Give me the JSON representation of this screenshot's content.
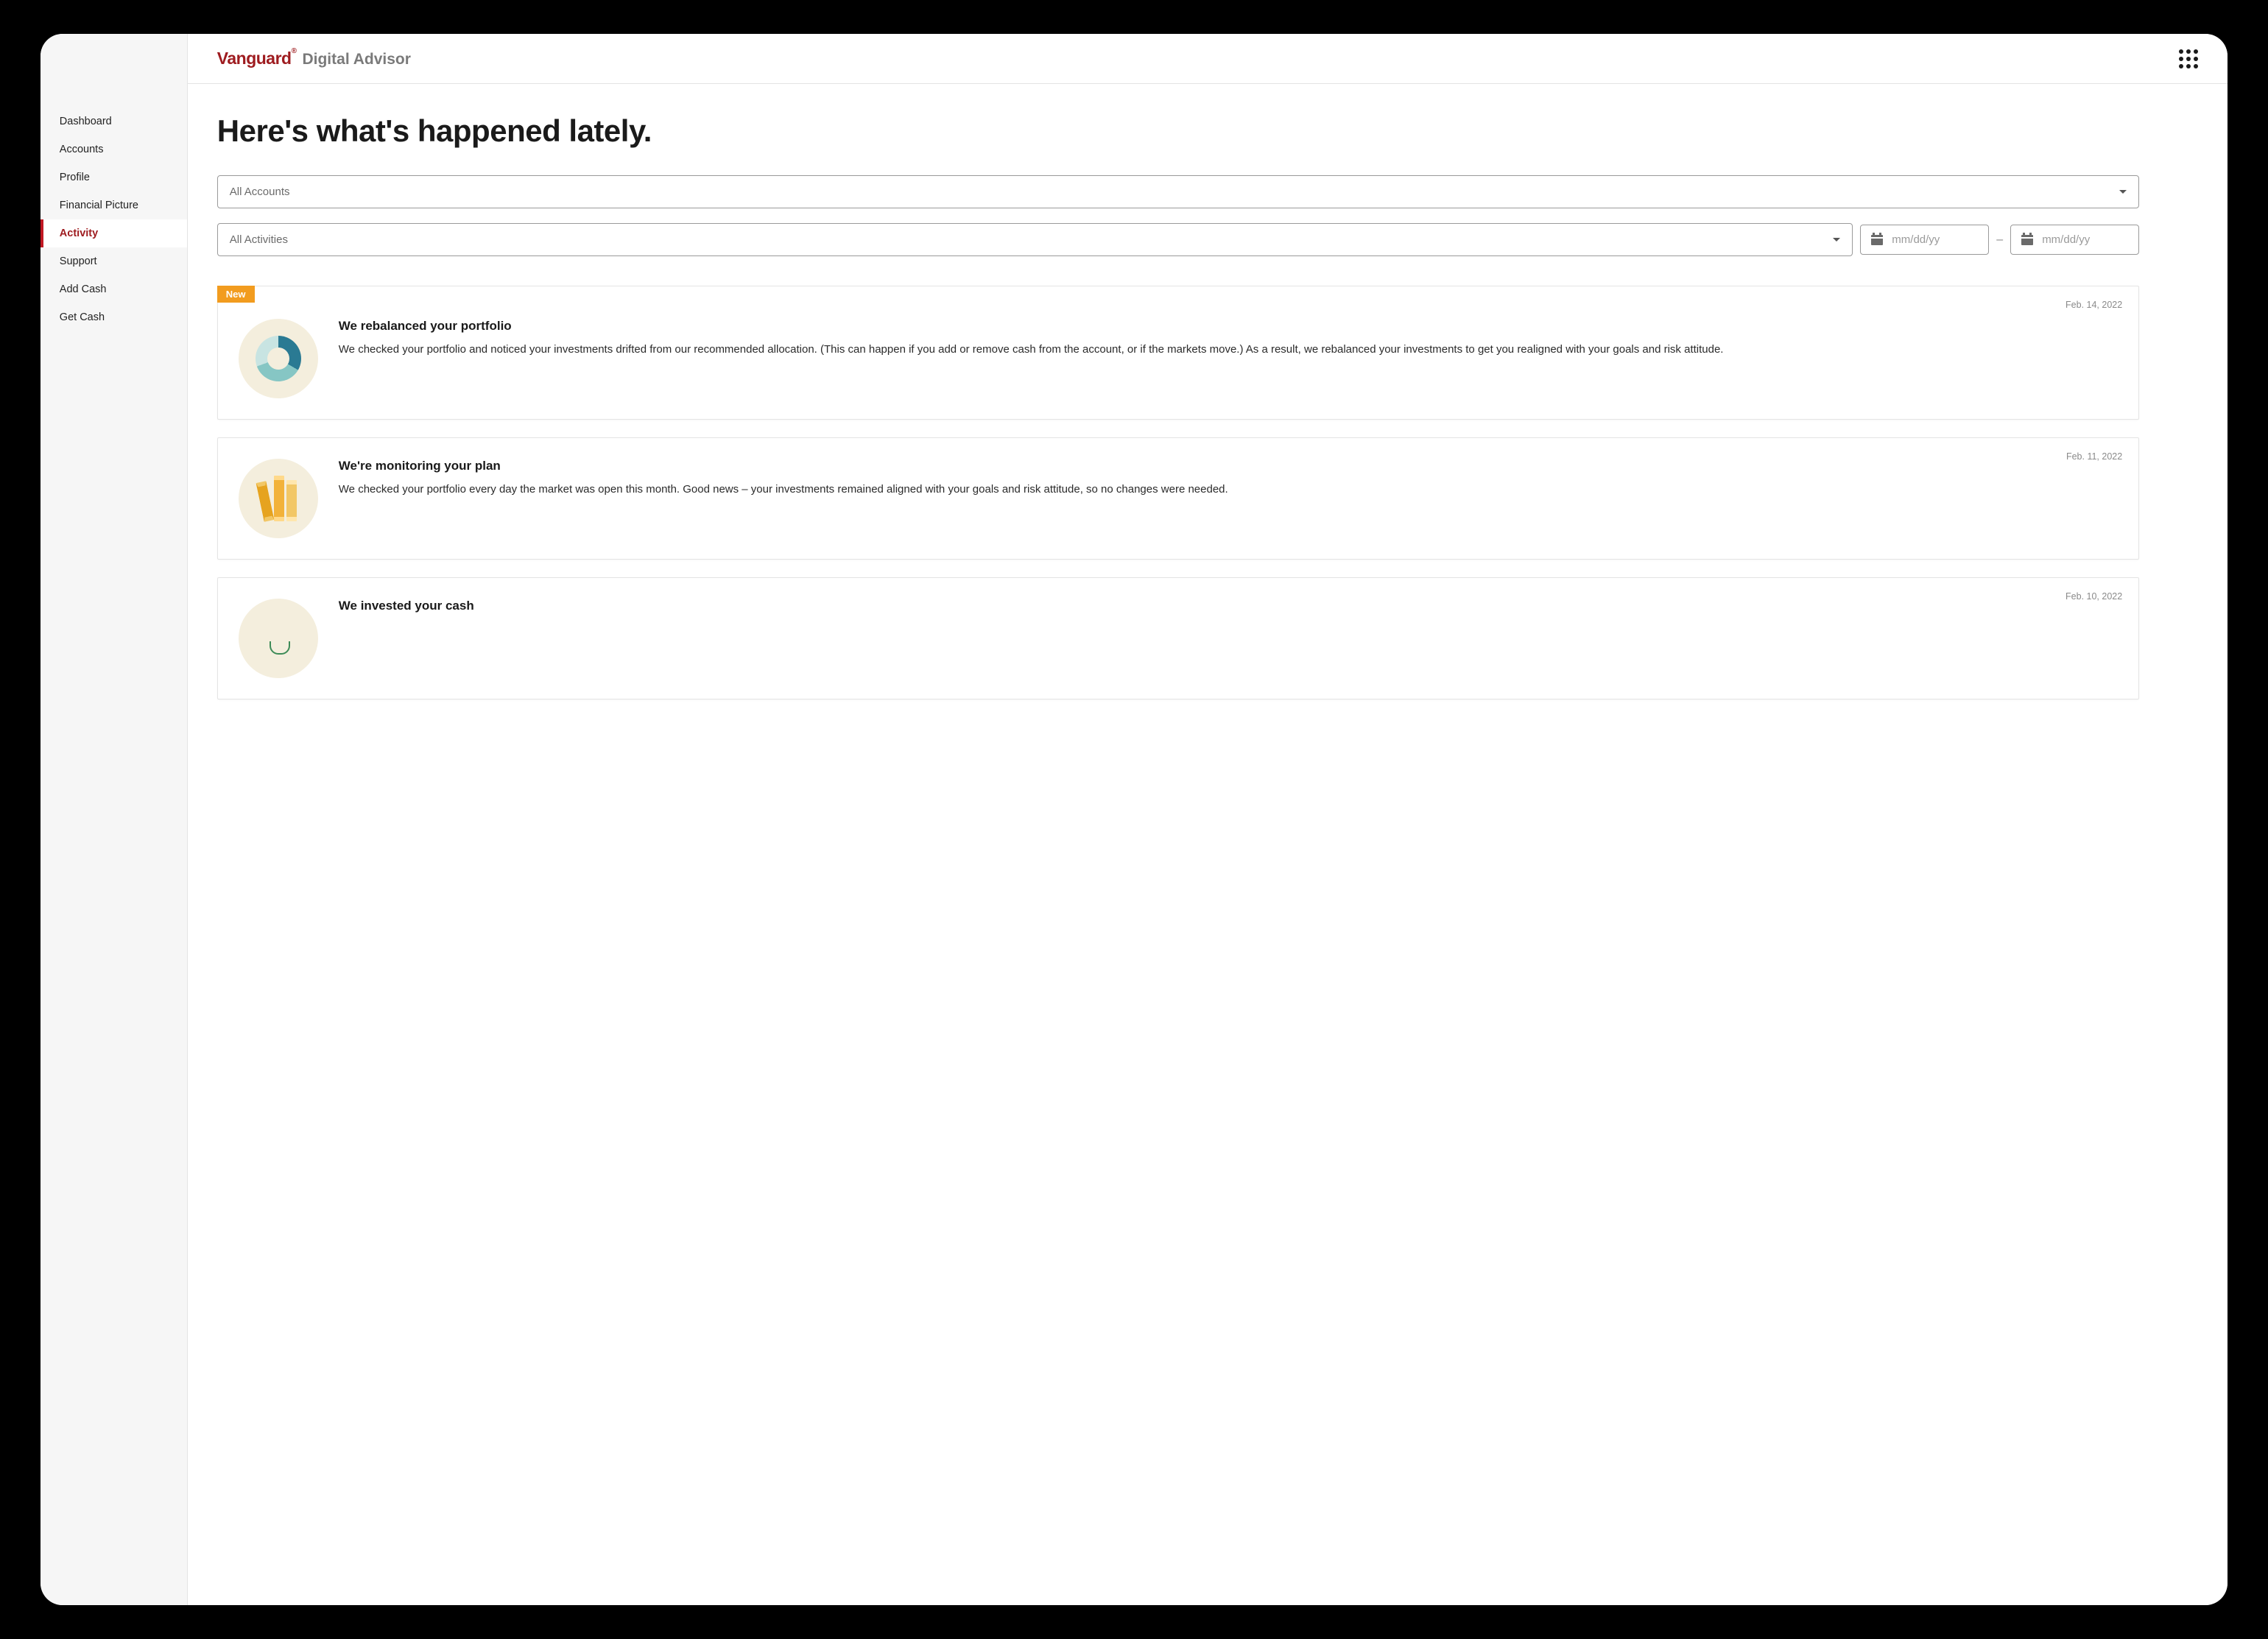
{
  "brand": {
    "logo": "Vanguard",
    "product": "Digital Advisor"
  },
  "sidebar": {
    "items": [
      {
        "label": "Dashboard",
        "active": false
      },
      {
        "label": "Accounts",
        "active": false
      },
      {
        "label": "Profile",
        "active": false
      },
      {
        "label": "Financial Picture",
        "active": false
      },
      {
        "label": "Activity",
        "active": true
      },
      {
        "label": "Support",
        "active": false
      },
      {
        "label": "Add Cash",
        "active": false
      },
      {
        "label": "Get Cash",
        "active": false
      }
    ]
  },
  "page": {
    "title": "Here's what's happened lately."
  },
  "filters": {
    "account_select": "All Accounts",
    "activity_select": "All Activities",
    "date_from_placeholder": "mm/dd/yy",
    "date_to_placeholder": "mm/dd/yy",
    "range_separator": "–"
  },
  "badges": {
    "new": "New"
  },
  "activities": [
    {
      "icon": "donut",
      "is_new": true,
      "date": "Feb. 14, 2022",
      "title": "We rebalanced your portfolio",
      "description": "We checked your portfolio and noticed your investments drifted from our recommended allocation. (This can happen if you add or remove cash from the account, or if the markets move.) As a result, we rebalanced your investments to get you realigned with your goals and risk attitude."
    },
    {
      "icon": "books",
      "is_new": false,
      "date": "Feb. 11, 2022",
      "title": "We're monitoring your plan",
      "description": "We checked your portfolio every day the market was open this month. Good news – your investments remained aligned with your goals and risk attitude, so no changes were needed."
    },
    {
      "icon": "plant",
      "is_new": false,
      "date": "Feb. 10, 2022",
      "title": "We invested your cash",
      "description": ""
    }
  ]
}
